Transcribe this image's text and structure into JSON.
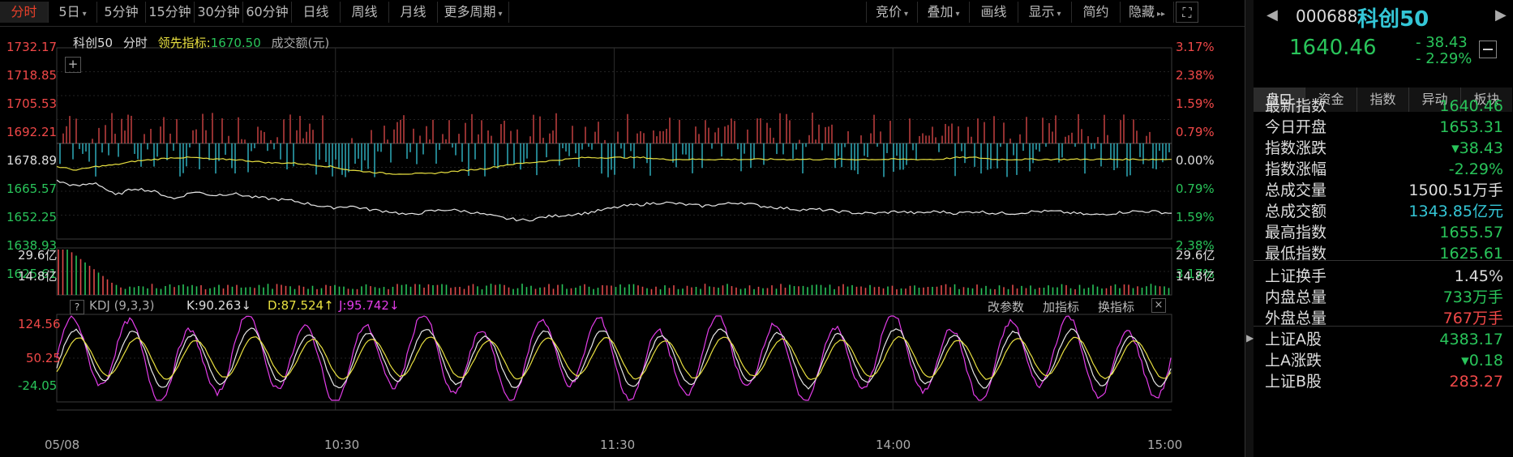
{
  "toolbar": {
    "left_tabs": [
      {
        "label": "分时",
        "active": true,
        "caret": false
      },
      {
        "label": "5日",
        "active": false,
        "caret": true
      },
      {
        "label": "5分钟",
        "active": false,
        "caret": false
      },
      {
        "label": "15分钟",
        "active": false,
        "caret": false
      },
      {
        "label": "30分钟",
        "active": false,
        "caret": false
      },
      {
        "label": "60分钟",
        "active": false,
        "caret": false
      },
      {
        "label": "日线",
        "active": false,
        "caret": false
      },
      {
        "label": "周线",
        "active": false,
        "caret": false
      },
      {
        "label": "月线",
        "active": false,
        "caret": false
      },
      {
        "label": "更多周期",
        "active": false,
        "caret": true
      }
    ],
    "right_tabs": [
      {
        "label": "竞价",
        "caret": true
      },
      {
        "label": "叠加",
        "caret": true
      },
      {
        "label": "画线",
        "caret": false
      },
      {
        "label": "显示",
        "caret": true
      },
      {
        "label": "简约",
        "caret": false
      },
      {
        "label": "隐藏",
        "caret": false
      }
    ]
  },
  "chart_header": {
    "name": "科创50",
    "mode": "分时",
    "lead_label": "领先指标:",
    "lead_value": "1670.50",
    "volume_label": "成交额(元)"
  },
  "price_axis_left": [
    "1732.17",
    "1718.85",
    "1705.53",
    "1692.21",
    "1678.89",
    "1665.57",
    "1652.25",
    "1638.93",
    "1625.61"
  ],
  "pct_axis_right": [
    "3.17%",
    "2.38%",
    "1.59%",
    "0.79%",
    "0.00%",
    "0.79%",
    "1.59%",
    "2.38%",
    "3.17%"
  ],
  "volume_axis": {
    "top": "29.6亿",
    "mid": "14.8亿"
  },
  "kdj": {
    "name": "KDJ (9,3,3)",
    "k_label": "K:90.263↓",
    "d_label": "D:87.524↑",
    "j_label": "J:95.742↓",
    "axis": [
      "124.56",
      "50.25",
      "-24.05"
    ],
    "buttons": [
      "改参数",
      "加指标",
      "换指标"
    ]
  },
  "time_axis": [
    "05/08",
    "10:30",
    "11:30",
    "14:00",
    "15:00"
  ],
  "colors": {
    "up": "#f04848",
    "down": "#29c45a",
    "price_line": "#e8e8e8",
    "avg_line": "#e8e040",
    "bar_down": "#34c6d6",
    "magenta": "#e23ce8"
  },
  "chart_data": {
    "type": "line",
    "title": "科创50",
    "ylim": [
      1625.61,
      1732.17
    ],
    "prev_close": 1678.89,
    "series": [
      {
        "name": "price",
        "values": [
          1658,
          1655,
          1657,
          1650,
          1654,
          1652,
          1648,
          1652,
          1650,
          1651,
          1649,
          1648,
          1647,
          1645,
          1643,
          1644,
          1642,
          1641,
          1639,
          1641,
          1642,
          1641,
          1639,
          1637,
          1636,
          1638,
          1639,
          1640,
          1642,
          1644,
          1645,
          1646,
          1645,
          1644,
          1645,
          1646,
          1644,
          1643,
          1642,
          1642,
          1641,
          1640,
          1640,
          1641,
          1640,
          1641,
          1640,
          1641,
          1640,
          1640,
          1641,
          1641,
          1640,
          1639,
          1640,
          1641,
          1641,
          1640
        ]
      },
      {
        "name": "领先指标",
        "values": [
          1666,
          1664,
          1666,
          1667,
          1669,
          1670,
          1671,
          1671,
          1670,
          1670,
          1669,
          1668,
          1668,
          1667,
          1666,
          1664,
          1663,
          1662,
          1662,
          1662,
          1663,
          1664,
          1665,
          1667,
          1668,
          1669,
          1670,
          1671,
          1671,
          1671,
          1671,
          1670,
          1670,
          1670,
          1670,
          1670,
          1670,
          1670,
          1670,
          1670,
          1670,
          1670,
          1670,
          1670,
          1670,
          1670,
          1671,
          1671,
          1670,
          1670,
          1670,
          1670,
          1670,
          1670,
          1670,
          1670,
          1670,
          1670
        ]
      }
    ],
    "xlabel": "",
    "ylabel": ""
  },
  "panel": {
    "code": "000688",
    "name": "科创50",
    "price": "1640.46",
    "change": "- 38.43",
    "change_pct": "- 2.29%",
    "tabs": [
      "盘口",
      "资金",
      "指数",
      "异动",
      "板块"
    ],
    "rows": [
      {
        "k": "最新指数",
        "v": "1640.46",
        "c": "green"
      },
      {
        "k": "今日开盘",
        "v": "1653.31",
        "c": "green"
      },
      {
        "k": "指数涨跌",
        "v": "▾38.43",
        "c": "green"
      },
      {
        "k": "指数涨幅",
        "v": "-2.29%",
        "c": "green"
      },
      {
        "k": "总成交量",
        "v": "1500.51",
        "u": "万手",
        "c": "white"
      },
      {
        "k": "总成交额",
        "v": "1343.85",
        "u": "亿元",
        "c": "cyan"
      },
      {
        "k": "最高指数",
        "v": "1655.57",
        "c": "green"
      },
      {
        "k": "最低指数",
        "v": "1625.61",
        "c": "green"
      },
      {
        "k": "上证换手",
        "v": "1.45%",
        "c": "white"
      },
      {
        "k": "内盘总量",
        "v": "733",
        "u": "万手",
        "c": "green"
      },
      {
        "k": "外盘总量",
        "v": "767",
        "u": "万手",
        "c": "red"
      },
      {
        "k": "上证A股",
        "v": "4383.17",
        "c": "green"
      },
      {
        "k": "上A涨跌",
        "v": "▾0.18",
        "c": "green"
      },
      {
        "k": "上证B股",
        "v": "283.27",
        "c": "red"
      }
    ]
  }
}
